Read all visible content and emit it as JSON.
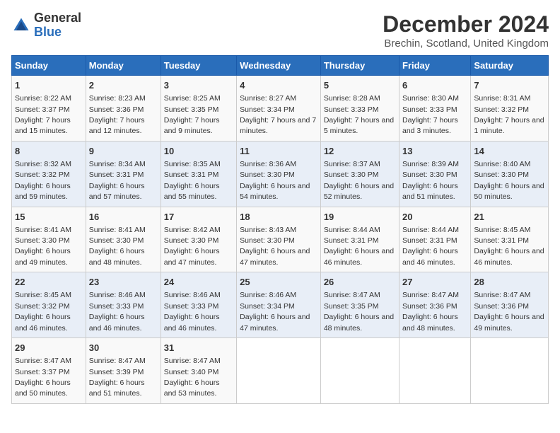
{
  "logo": {
    "general": "General",
    "blue": "Blue"
  },
  "title": "December 2024",
  "subtitle": "Brechin, Scotland, United Kingdom",
  "days_of_week": [
    "Sunday",
    "Monday",
    "Tuesday",
    "Wednesday",
    "Thursday",
    "Friday",
    "Saturday"
  ],
  "weeks": [
    [
      {
        "day": "1",
        "sunrise": "Sunrise: 8:22 AM",
        "sunset": "Sunset: 3:37 PM",
        "daylight": "Daylight: 7 hours and 15 minutes."
      },
      {
        "day": "2",
        "sunrise": "Sunrise: 8:23 AM",
        "sunset": "Sunset: 3:36 PM",
        "daylight": "Daylight: 7 hours and 12 minutes."
      },
      {
        "day": "3",
        "sunrise": "Sunrise: 8:25 AM",
        "sunset": "Sunset: 3:35 PM",
        "daylight": "Daylight: 7 hours and 9 minutes."
      },
      {
        "day": "4",
        "sunrise": "Sunrise: 8:27 AM",
        "sunset": "Sunset: 3:34 PM",
        "daylight": "Daylight: 7 hours and 7 minutes."
      },
      {
        "day": "5",
        "sunrise": "Sunrise: 8:28 AM",
        "sunset": "Sunset: 3:33 PM",
        "daylight": "Daylight: 7 hours and 5 minutes."
      },
      {
        "day": "6",
        "sunrise": "Sunrise: 8:30 AM",
        "sunset": "Sunset: 3:33 PM",
        "daylight": "Daylight: 7 hours and 3 minutes."
      },
      {
        "day": "7",
        "sunrise": "Sunrise: 8:31 AM",
        "sunset": "Sunset: 3:32 PM",
        "daylight": "Daylight: 7 hours and 1 minute."
      }
    ],
    [
      {
        "day": "8",
        "sunrise": "Sunrise: 8:32 AM",
        "sunset": "Sunset: 3:32 PM",
        "daylight": "Daylight: 6 hours and 59 minutes."
      },
      {
        "day": "9",
        "sunrise": "Sunrise: 8:34 AM",
        "sunset": "Sunset: 3:31 PM",
        "daylight": "Daylight: 6 hours and 57 minutes."
      },
      {
        "day": "10",
        "sunrise": "Sunrise: 8:35 AM",
        "sunset": "Sunset: 3:31 PM",
        "daylight": "Daylight: 6 hours and 55 minutes."
      },
      {
        "day": "11",
        "sunrise": "Sunrise: 8:36 AM",
        "sunset": "Sunset: 3:30 PM",
        "daylight": "Daylight: 6 hours and 54 minutes."
      },
      {
        "day": "12",
        "sunrise": "Sunrise: 8:37 AM",
        "sunset": "Sunset: 3:30 PM",
        "daylight": "Daylight: 6 hours and 52 minutes."
      },
      {
        "day": "13",
        "sunrise": "Sunrise: 8:39 AM",
        "sunset": "Sunset: 3:30 PM",
        "daylight": "Daylight: 6 hours and 51 minutes."
      },
      {
        "day": "14",
        "sunrise": "Sunrise: 8:40 AM",
        "sunset": "Sunset: 3:30 PM",
        "daylight": "Daylight: 6 hours and 50 minutes."
      }
    ],
    [
      {
        "day": "15",
        "sunrise": "Sunrise: 8:41 AM",
        "sunset": "Sunset: 3:30 PM",
        "daylight": "Daylight: 6 hours and 49 minutes."
      },
      {
        "day": "16",
        "sunrise": "Sunrise: 8:41 AM",
        "sunset": "Sunset: 3:30 PM",
        "daylight": "Daylight: 6 hours and 48 minutes."
      },
      {
        "day": "17",
        "sunrise": "Sunrise: 8:42 AM",
        "sunset": "Sunset: 3:30 PM",
        "daylight": "Daylight: 6 hours and 47 minutes."
      },
      {
        "day": "18",
        "sunrise": "Sunrise: 8:43 AM",
        "sunset": "Sunset: 3:30 PM",
        "daylight": "Daylight: 6 hours and 47 minutes."
      },
      {
        "day": "19",
        "sunrise": "Sunrise: 8:44 AM",
        "sunset": "Sunset: 3:31 PM",
        "daylight": "Daylight: 6 hours and 46 minutes."
      },
      {
        "day": "20",
        "sunrise": "Sunrise: 8:44 AM",
        "sunset": "Sunset: 3:31 PM",
        "daylight": "Daylight: 6 hours and 46 minutes."
      },
      {
        "day": "21",
        "sunrise": "Sunrise: 8:45 AM",
        "sunset": "Sunset: 3:31 PM",
        "daylight": "Daylight: 6 hours and 46 minutes."
      }
    ],
    [
      {
        "day": "22",
        "sunrise": "Sunrise: 8:45 AM",
        "sunset": "Sunset: 3:32 PM",
        "daylight": "Daylight: 6 hours and 46 minutes."
      },
      {
        "day": "23",
        "sunrise": "Sunrise: 8:46 AM",
        "sunset": "Sunset: 3:33 PM",
        "daylight": "Daylight: 6 hours and 46 minutes."
      },
      {
        "day": "24",
        "sunrise": "Sunrise: 8:46 AM",
        "sunset": "Sunset: 3:33 PM",
        "daylight": "Daylight: 6 hours and 46 minutes."
      },
      {
        "day": "25",
        "sunrise": "Sunrise: 8:46 AM",
        "sunset": "Sunset: 3:34 PM",
        "daylight": "Daylight: 6 hours and 47 minutes."
      },
      {
        "day": "26",
        "sunrise": "Sunrise: 8:47 AM",
        "sunset": "Sunset: 3:35 PM",
        "daylight": "Daylight: 6 hours and 48 minutes."
      },
      {
        "day": "27",
        "sunrise": "Sunrise: 8:47 AM",
        "sunset": "Sunset: 3:36 PM",
        "daylight": "Daylight: 6 hours and 48 minutes."
      },
      {
        "day": "28",
        "sunrise": "Sunrise: 8:47 AM",
        "sunset": "Sunset: 3:36 PM",
        "daylight": "Daylight: 6 hours and 49 minutes."
      }
    ],
    [
      {
        "day": "29",
        "sunrise": "Sunrise: 8:47 AM",
        "sunset": "Sunset: 3:37 PM",
        "daylight": "Daylight: 6 hours and 50 minutes."
      },
      {
        "day": "30",
        "sunrise": "Sunrise: 8:47 AM",
        "sunset": "Sunset: 3:39 PM",
        "daylight": "Daylight: 6 hours and 51 minutes."
      },
      {
        "day": "31",
        "sunrise": "Sunrise: 8:47 AM",
        "sunset": "Sunset: 3:40 PM",
        "daylight": "Daylight: 6 hours and 53 minutes."
      },
      null,
      null,
      null,
      null
    ]
  ]
}
